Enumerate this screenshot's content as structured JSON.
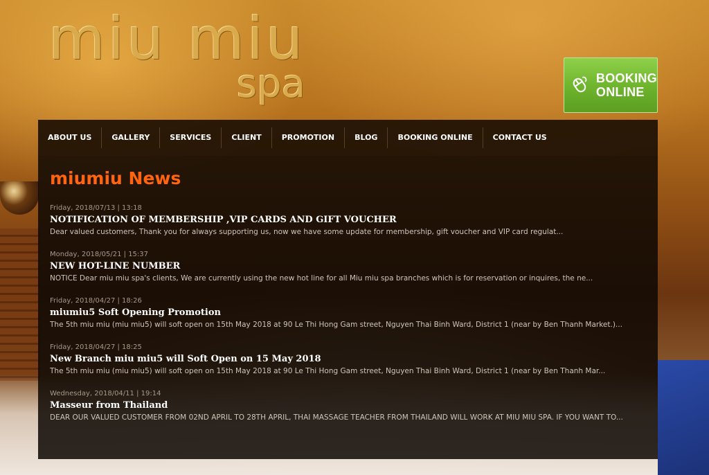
{
  "logo": {
    "main_text": "miu miu",
    "sub_text": "spa"
  },
  "booking_button": {
    "line1": "BOOKING",
    "line2": "ONLINE",
    "icon": "mouse-cursor-icon",
    "color": "#6db32c"
  },
  "nav": {
    "items": [
      {
        "label": "ABOUT US"
      },
      {
        "label": "GALLERY"
      },
      {
        "label": "SERVICES"
      },
      {
        "label": "CLIENT"
      },
      {
        "label": "PROMOTION"
      },
      {
        "label": "BLOG"
      },
      {
        "label": "BOOKING ONLINE"
      },
      {
        "label": "CONTACT US"
      }
    ]
  },
  "page": {
    "title": "miumiu News",
    "title_color": "#ff6410"
  },
  "news": [
    {
      "date": "Friday, 2018/07/13 | 13:18",
      "title": "NOTIFICATION OF MEMBERSHIP ,VIP CARDS AND GIFT VOUCHER",
      "excerpt": "Dear valued customers, Thank you for always supporting us, now we have some update  for membership, gift voucher  and VIP card regulat..."
    },
    {
      "date": "Monday, 2018/05/21 | 15:37",
      "title": "NEW HOT-LINE NUMBER",
      "excerpt": "NOTICE Dear miu miu spa's clients, We are currently using the new hot line for all Miu miu spa branches which is for reservation or inquires, the ne..."
    },
    {
      "date": "Friday, 2018/04/27 | 18:26",
      "title": "miumiu5 Soft Opening Promotion",
      "excerpt": "The 5th miu miu (miu miu5) will soft open on 15th May 2018 at 90 Le Thi Hong Gam street, Nguyen Thai Binh Ward, District 1 (near by Ben Thanh Market.)..."
    },
    {
      "date": "Friday, 2018/04/27 | 18:25",
      "title": "New Branch miu miu5 will Soft Open on 15 May 2018",
      "excerpt": "The 5th miu miu (miu miu5) will soft open on 15th May 2018 at 90 Le Thi Hong Gam street, Nguyen Thai Binh Ward, District 1 (near by Ben Thanh Mar..."
    },
    {
      "date": "Wednesday, 2018/04/11 | 19:14",
      "title": "Masseur from Thailand",
      "excerpt": "DEAR OUR VALUED CUSTOMER FROM 02ND  APRIL TO 28TH  APRIL, THAI MASSAGE TEACHER FROM THAILAND  WILL WORK AT MIU MIU SPA. IF YOU WANT TO..."
    }
  ]
}
